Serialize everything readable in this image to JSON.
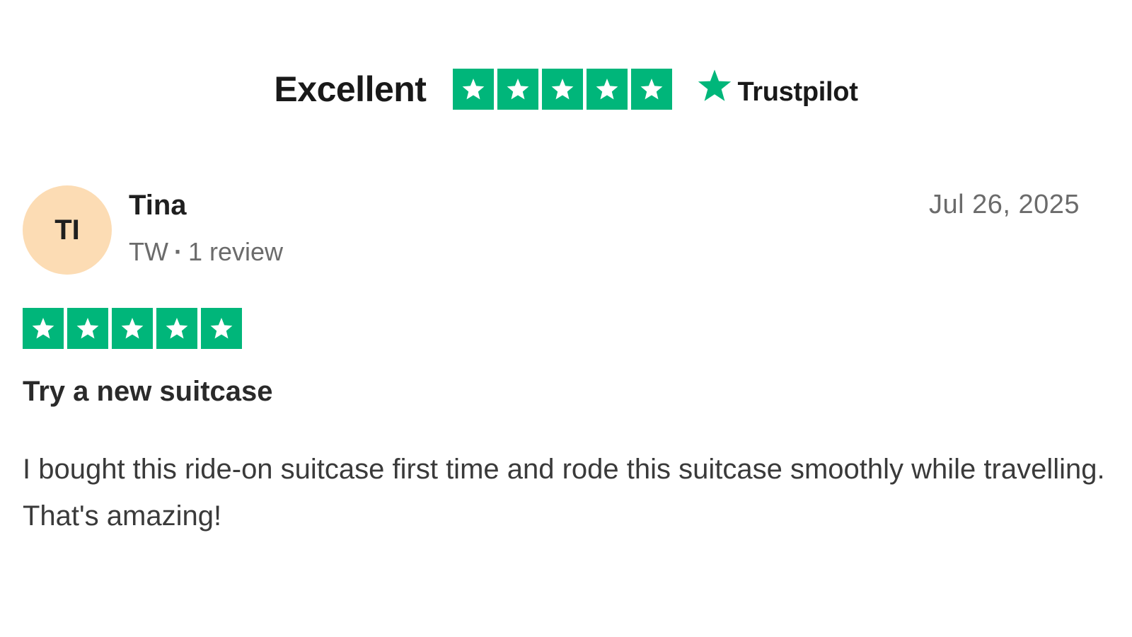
{
  "summary": {
    "label": "Excellent",
    "stars_filled": 5,
    "stars_total": 5,
    "brand_name": "Trustpilot",
    "brand_star_icon": "trustpilot-star-icon",
    "star_color": "#00b67a"
  },
  "review": {
    "avatar_initials": "TI",
    "avatar_color": "#fcdcb4",
    "reviewer_name": "Tina",
    "reviewer_country": "TW",
    "reviewer_review_count": "1 review",
    "date": "Jul 26, 2025",
    "stars_filled": 5,
    "stars_total": 5,
    "title": "Try a new suitcase",
    "body": "I bought this ride-on suitcase first time and rode this suitcase smoothly while travelling. That's amazing!"
  }
}
